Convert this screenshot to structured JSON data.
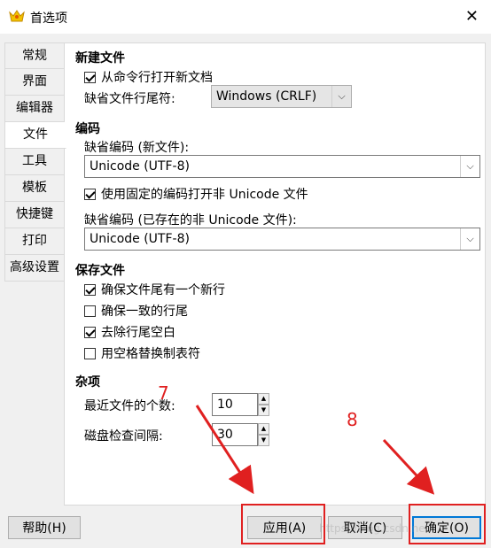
{
  "window": {
    "title": "首选项",
    "icon": "crown-icon",
    "close_symbol": "✕"
  },
  "tabs": [
    {
      "label": "常规",
      "active": false
    },
    {
      "label": "界面",
      "active": false
    },
    {
      "label": "编辑器",
      "active": false
    },
    {
      "label": "文件",
      "active": true
    },
    {
      "label": "工具",
      "active": false
    },
    {
      "label": "模板",
      "active": false
    },
    {
      "label": "快捷键",
      "active": false
    },
    {
      "label": "打印",
      "active": false
    },
    {
      "label": "高级设置",
      "active": false
    }
  ],
  "new_file": {
    "title": "新建文件",
    "open_from_cmdline_label": "从命令行打开新文档",
    "open_from_cmdline_checked": true,
    "eol_label": "缺省文件行尾符:",
    "eol_value": "Windows (CRLF)"
  },
  "encoding": {
    "title": "编码",
    "default_new_label": "缺省编码 (新文件):",
    "default_new_value": "Unicode (UTF-8)",
    "fixed_label": "使用固定的编码打开非 Unicode 文件",
    "fixed_checked": true,
    "default_existing_label": "缺省编码 (已存在的非 Unicode 文件):",
    "default_existing_value": "Unicode (UTF-8)"
  },
  "save": {
    "title": "保存文件",
    "options": [
      {
        "label": "确保文件尾有一个新行",
        "checked": true
      },
      {
        "label": "确保一致的行尾",
        "checked": false
      },
      {
        "label": "去除行尾空白",
        "checked": true
      },
      {
        "label": "用空格替换制表符",
        "checked": false
      }
    ]
  },
  "misc": {
    "title": "杂项",
    "recent_label": "最近文件的个数:",
    "recent_value": "10",
    "disk_check_label": "磁盘检查间隔:",
    "disk_check_value": "30"
  },
  "buttons": {
    "help": "帮助(H)",
    "apply": "应用(A)",
    "cancel": "取消(C)",
    "ok": "确定(O)"
  },
  "annotations": {
    "apply_number": "7",
    "ok_number": "8",
    "highlight_color": "#e02020"
  },
  "watermark": "https://blog.csdn.net/..."
}
